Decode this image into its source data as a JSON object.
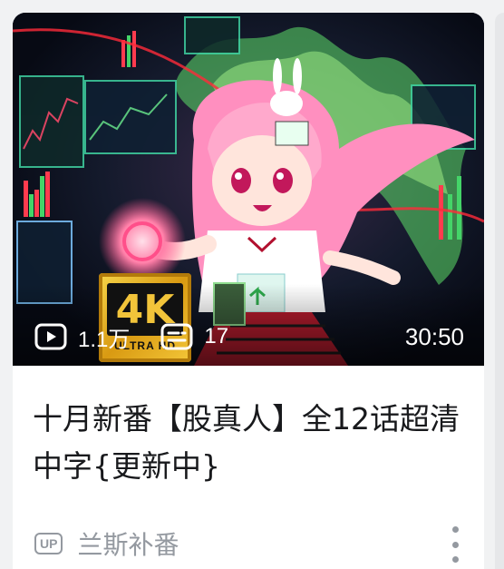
{
  "video": {
    "title": "十月新番【股真人】全12话超清中字{更新中}",
    "views": "1.1万",
    "danmaku": "17",
    "duration": "30:50",
    "badge_text": "4K",
    "badge_subtext": "ULTRA HD"
  },
  "uploader": {
    "up_label": "UP",
    "name": "兰斯补番"
  },
  "icons": {
    "views": "play-icon",
    "danmaku": "danmaku-icon",
    "more": "more-vertical-icon"
  },
  "colors": {
    "card_bg": "#ffffff",
    "page_bg": "#f1f2f3",
    "title_text": "#18191c",
    "meta_text": "#9499a0"
  }
}
